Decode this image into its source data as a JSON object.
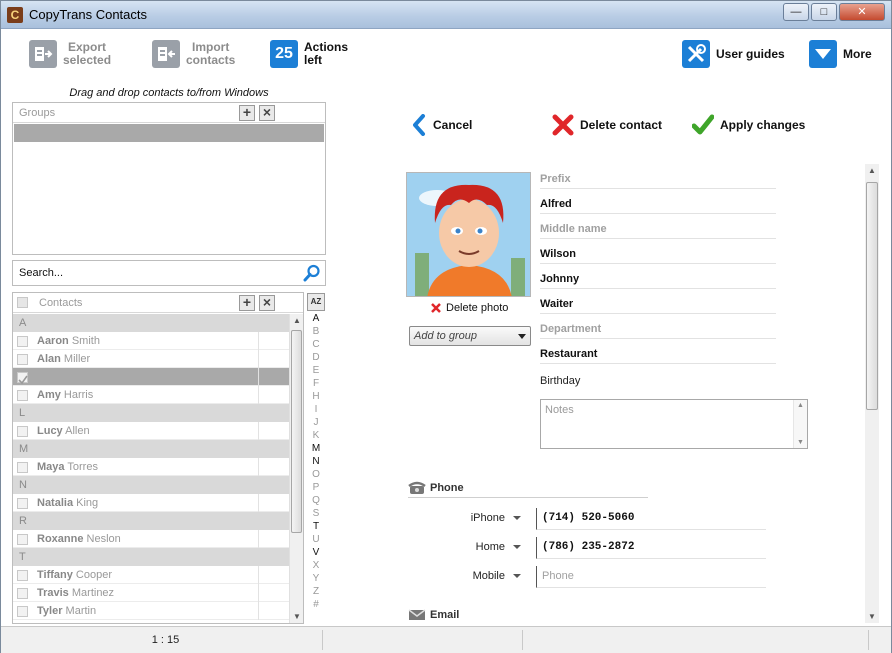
{
  "window": {
    "title": "CopyTrans Contacts",
    "icon": "C"
  },
  "toolbar": {
    "export": {
      "line1": "Export",
      "line2": "selected",
      "icon": "export-icon"
    },
    "import": {
      "line1": "Import",
      "line2": "contacts",
      "icon": "import-icon"
    },
    "actions": {
      "count": "25",
      "line1": "Actions",
      "line2": "left"
    },
    "user_guides": {
      "label": "User guides",
      "icon": "tools-icon"
    },
    "more": {
      "label": "More",
      "icon": "chevron-down-icon"
    }
  },
  "drag_hint": "Drag and drop contacts to/from Windows",
  "groups": {
    "header": "Groups"
  },
  "search": {
    "placeholder": "Search..."
  },
  "contacts": {
    "header": "Contacts",
    "rows": [
      {
        "type": "letter",
        "text": "A"
      },
      {
        "type": "contact",
        "first": "Aaron",
        "last": "Smith"
      },
      {
        "type": "contact",
        "first": "Alan",
        "last": "Miller"
      },
      {
        "type": "contact",
        "first": "",
        "last": "",
        "selected": true
      },
      {
        "type": "contact",
        "first": "Amy",
        "last": "Harris"
      },
      {
        "type": "letter",
        "text": "L"
      },
      {
        "type": "contact",
        "first": "Lucy",
        "last": "Allen"
      },
      {
        "type": "letter",
        "text": "M"
      },
      {
        "type": "contact",
        "first": "Maya",
        "last": "Torres"
      },
      {
        "type": "letter",
        "text": "N"
      },
      {
        "type": "contact",
        "first": "Natalia",
        "last": "King"
      },
      {
        "type": "letter",
        "text": "R"
      },
      {
        "type": "contact",
        "first": "Roxanne",
        "last": "Neslon"
      },
      {
        "type": "letter",
        "text": "T"
      },
      {
        "type": "contact",
        "first": "Tiffany",
        "last": "Cooper"
      },
      {
        "type": "contact",
        "first": "Travis",
        "last": "Martinez"
      },
      {
        "type": "contact",
        "first": "Tyler",
        "last": "Martin"
      }
    ]
  },
  "az_button": "AZ",
  "alphabet": [
    {
      "l": "A",
      "active": true
    },
    {
      "l": "B",
      "active": false
    },
    {
      "l": "C",
      "active": false
    },
    {
      "l": "D",
      "active": false
    },
    {
      "l": "E",
      "active": false
    },
    {
      "l": "F",
      "active": false
    },
    {
      "l": "H",
      "active": false
    },
    {
      "l": "I",
      "active": false
    },
    {
      "l": "J",
      "active": false
    },
    {
      "l": "K",
      "active": false
    },
    {
      "l": "M",
      "active": true
    },
    {
      "l": "N",
      "active": true
    },
    {
      "l": "O",
      "active": false
    },
    {
      "l": "P",
      "active": false
    },
    {
      "l": "Q",
      "active": false
    },
    {
      "l": "S",
      "active": false
    },
    {
      "l": "T",
      "active": true
    },
    {
      "l": "U",
      "active": false
    },
    {
      "l": "V",
      "active": true
    },
    {
      "l": "X",
      "active": false
    },
    {
      "l": "Y",
      "active": false
    },
    {
      "l": "Z",
      "active": false
    },
    {
      "l": "#",
      "active": false
    }
  ],
  "actions": {
    "cancel": "Cancel",
    "delete": "Delete contact",
    "apply": "Apply changes"
  },
  "details": {
    "delete_photo": "Delete photo",
    "add_to_group": "Add to group",
    "fields": [
      {
        "value": "Prefix",
        "empty": true
      },
      {
        "value": "Alfred",
        "empty": false
      },
      {
        "value": "Middle name",
        "empty": true
      },
      {
        "value": "Wilson",
        "empty": false
      },
      {
        "value": "Johnny",
        "empty": false
      },
      {
        "value": "Waiter",
        "empty": false
      },
      {
        "value": "Department",
        "empty": true
      },
      {
        "value": "Restaurant",
        "empty": false
      }
    ],
    "birthday": "Birthday",
    "notes_placeholder": "Notes",
    "phone_section": "Phone",
    "phones": [
      {
        "type": "iPhone",
        "number": "(714) 520-5060",
        "empty": false
      },
      {
        "type": "Home",
        "number": "(786) 235-2872",
        "empty": false
      },
      {
        "type": "Mobile",
        "number": "Phone",
        "empty": true
      }
    ],
    "email_section": "Email"
  },
  "status": {
    "count": "1 : 15"
  },
  "colors": {
    "accent_blue": "#1c7fd6",
    "delete_red": "#e0262a",
    "apply_green": "#3fa52a",
    "selected_row": "#a9a9a9"
  }
}
